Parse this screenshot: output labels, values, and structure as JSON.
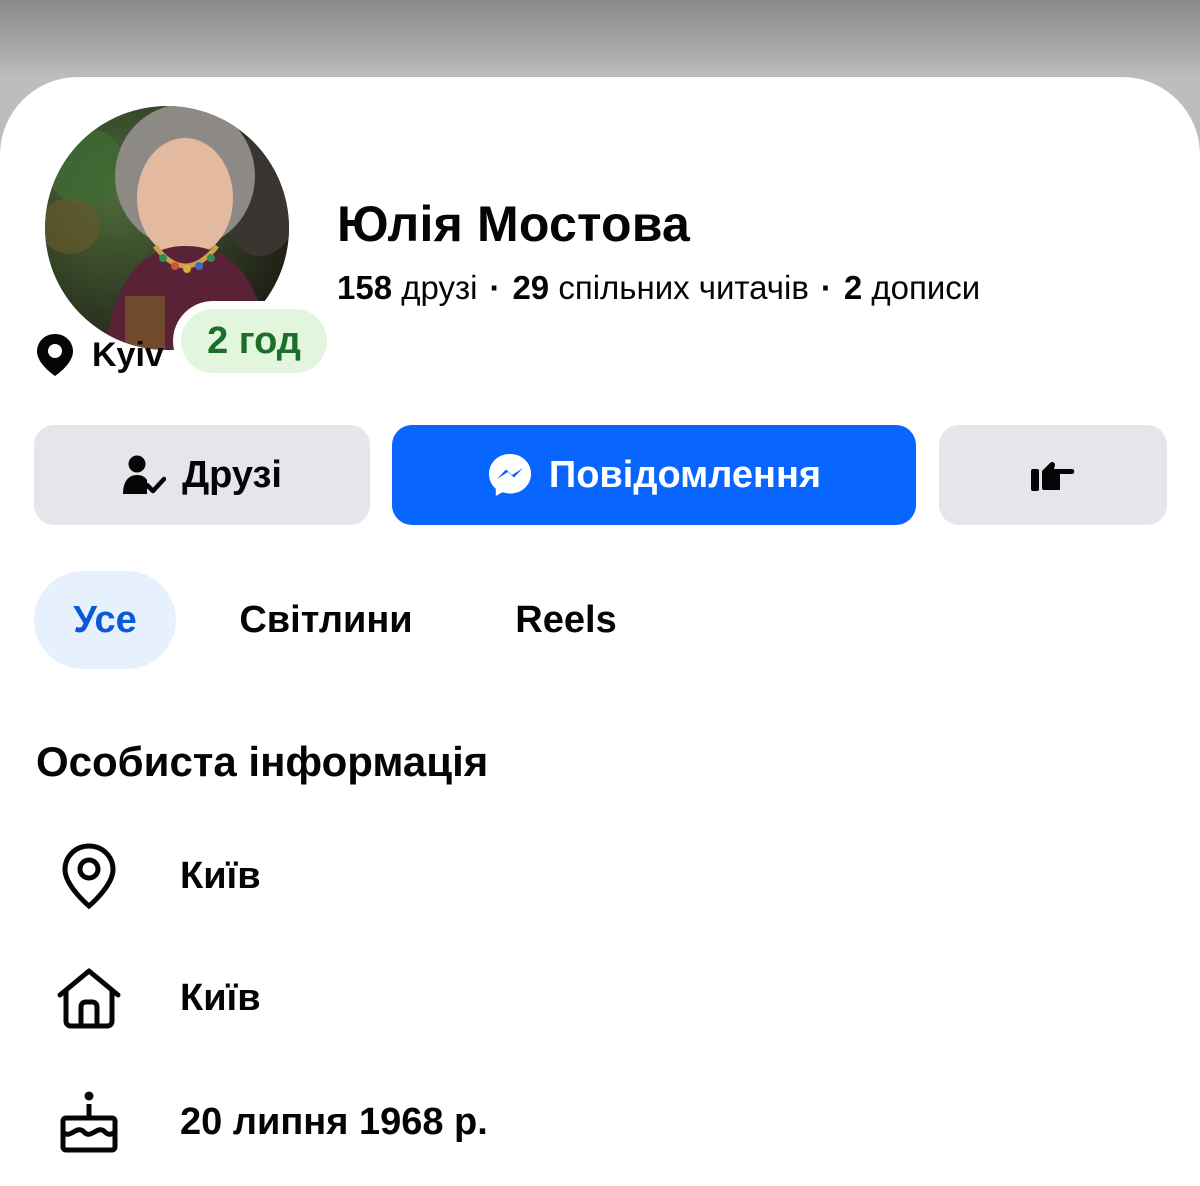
{
  "profile": {
    "name": "Юлія Мостова",
    "status_badge": "2 год",
    "location_short": "Kyiv"
  },
  "stats": {
    "friends_count": "158",
    "friends_label": "друзі",
    "followers_count": "29",
    "followers_label": "спільних читачів",
    "posts_count": "2",
    "posts_label": "дописи",
    "separator": "·"
  },
  "actions": {
    "friends_label": "Друзі",
    "message_label": "Повідомлення"
  },
  "tabs": [
    {
      "label": "Усе",
      "active": true
    },
    {
      "label": "Світлини",
      "active": false
    },
    {
      "label": "Reels",
      "active": false
    }
  ],
  "personal_info": {
    "title": "Особиста інформація",
    "items": [
      {
        "icon": "map-pin-icon",
        "text": "Київ"
      },
      {
        "icon": "home-icon",
        "text": "Київ"
      },
      {
        "icon": "birthday-cake-icon",
        "text": "20 липня 1968 р."
      }
    ]
  },
  "colors": {
    "accent": "#0866ff",
    "active_tab_bg": "#e7f1fd",
    "active_tab_text": "#0b59d6",
    "status_bg": "#e2f6dd",
    "status_text": "#1c6e2a",
    "secondary_button_bg": "#e4e6eb"
  }
}
